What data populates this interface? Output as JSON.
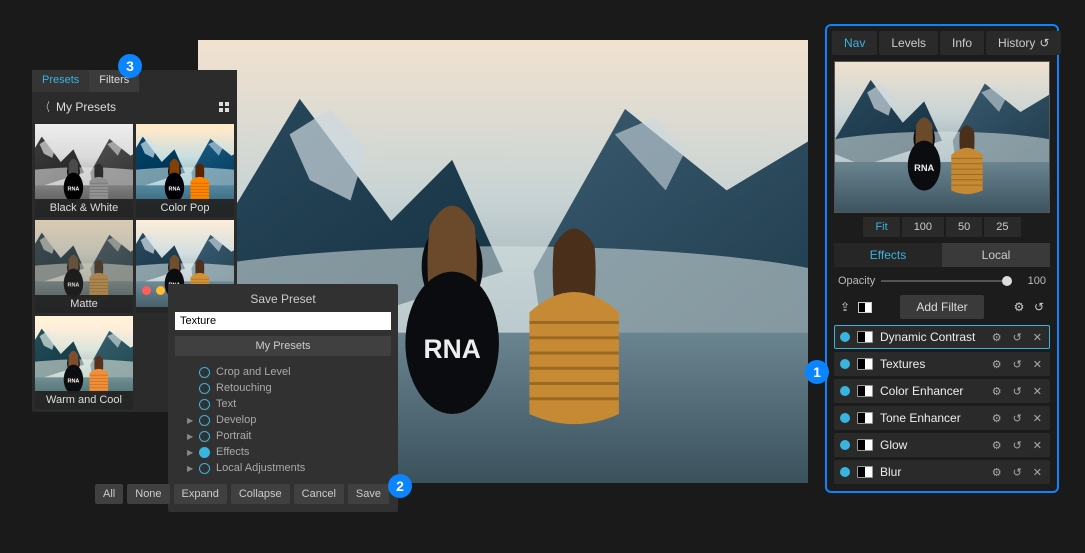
{
  "annotations": {
    "b1": "1",
    "b2": "2",
    "b3": "3"
  },
  "presets": {
    "tabs": {
      "presets": "Presets",
      "filters": "Filters"
    },
    "header": "My Presets",
    "items": [
      {
        "label": "Black & White"
      },
      {
        "label": "Color Pop"
      },
      {
        "label": "Matte"
      },
      {
        "label": ""
      },
      {
        "label": "Warm and Cool"
      }
    ]
  },
  "save_dialog": {
    "title": "Save Preset",
    "input_value": "Texture ",
    "dest_button": "My Presets",
    "tree": {
      "crop": "Crop and Level",
      "retouch": "Retouching",
      "text": "Text",
      "develop": "Develop",
      "portrait": "Portrait",
      "effects": "Effects",
      "local": "Local Adjustments"
    },
    "buttons": {
      "all": "All",
      "none": "None",
      "expand": "Expand",
      "collapse": "Collapse",
      "cancel": "Cancel",
      "save": "Save"
    }
  },
  "right": {
    "tabs": {
      "nav": "Nav",
      "levels": "Levels",
      "info": "Info",
      "history": "History"
    },
    "zoom": {
      "fit": "Fit",
      "z100": "100",
      "z50": "50",
      "z25": "25"
    },
    "fx_tabs": {
      "effects": "Effects",
      "local": "Local"
    },
    "opacity": {
      "label": "Opacity",
      "value": "100"
    },
    "add_filter": "Add Filter",
    "filters": [
      {
        "name": "Dynamic Contrast"
      },
      {
        "name": "Textures"
      },
      {
        "name": "Color Enhancer"
      },
      {
        "name": "Tone Enhancer"
      },
      {
        "name": "Glow"
      },
      {
        "name": "Blur"
      }
    ]
  }
}
